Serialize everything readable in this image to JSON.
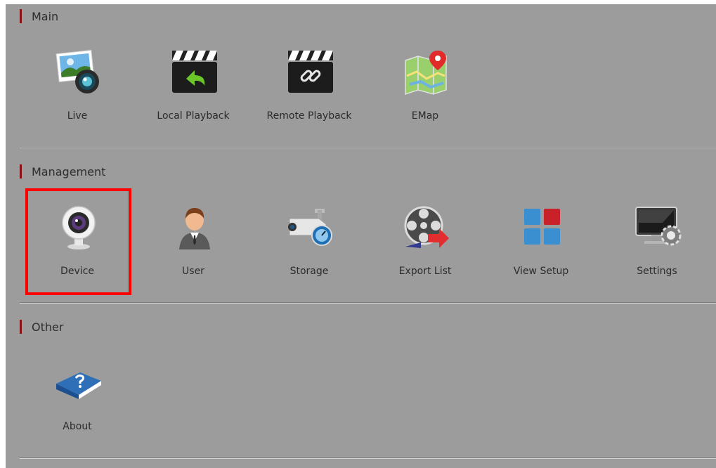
{
  "sections": {
    "main": {
      "title": "Main",
      "items": [
        {
          "label": "Live",
          "icon": "photo-camera-icon"
        },
        {
          "label": "Local Playback",
          "icon": "clapperboard-back-arrow-icon"
        },
        {
          "label": "Remote Playback",
          "icon": "clapperboard-link-icon"
        },
        {
          "label": "EMap",
          "icon": "map-pin-icon"
        }
      ]
    },
    "management": {
      "title": "Management",
      "items": [
        {
          "label": "Device",
          "icon": "webcam-icon"
        },
        {
          "label": "User",
          "icon": "user-person-icon"
        },
        {
          "label": "Storage",
          "icon": "cctv-camera-gauge-icon"
        },
        {
          "label": "Export List",
          "icon": "film-reel-export-icon"
        },
        {
          "label": "View Setup",
          "icon": "grid-layout-icon"
        },
        {
          "label": "Settings",
          "icon": "monitor-gear-icon"
        }
      ]
    },
    "other": {
      "title": "Other",
      "items": [
        {
          "label": "About",
          "icon": "help-book-icon"
        }
      ]
    }
  },
  "colors": {
    "panel_background": "#9c9c9c",
    "section_bar": "#8b1214",
    "highlight_border": "#ff0000"
  }
}
